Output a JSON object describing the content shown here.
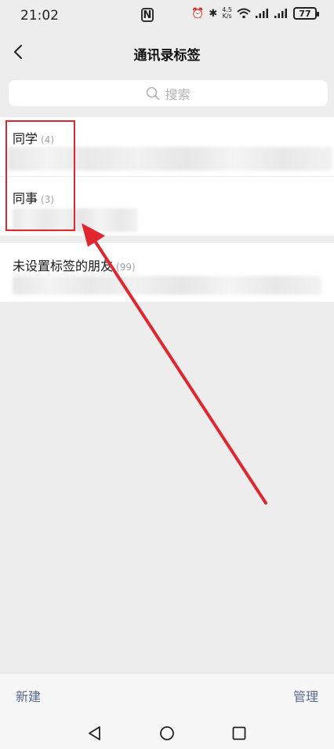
{
  "status_bar": {
    "time": "21:02",
    "nfc": "N",
    "speed_top": "4.5",
    "speed_bottom": "K/s",
    "battery": "77"
  },
  "header": {
    "title": "通讯录标签"
  },
  "search": {
    "placeholder": "搜索"
  },
  "groups": [
    {
      "name": "同学",
      "count": "(4)"
    },
    {
      "name": "同事",
      "count": "(3)"
    },
    {
      "name": "未设置标签的朋友",
      "count": "(99)"
    }
  ],
  "bottom_bar": {
    "new_label": "新建",
    "manage_label": "管理"
  },
  "colors": {
    "annotation": "#e0262e",
    "link": "#576b95",
    "background": "#ededed"
  },
  "icons": [
    "back-icon",
    "search-icon",
    "nav-back-icon",
    "nav-home-icon",
    "nav-recents-icon"
  ]
}
